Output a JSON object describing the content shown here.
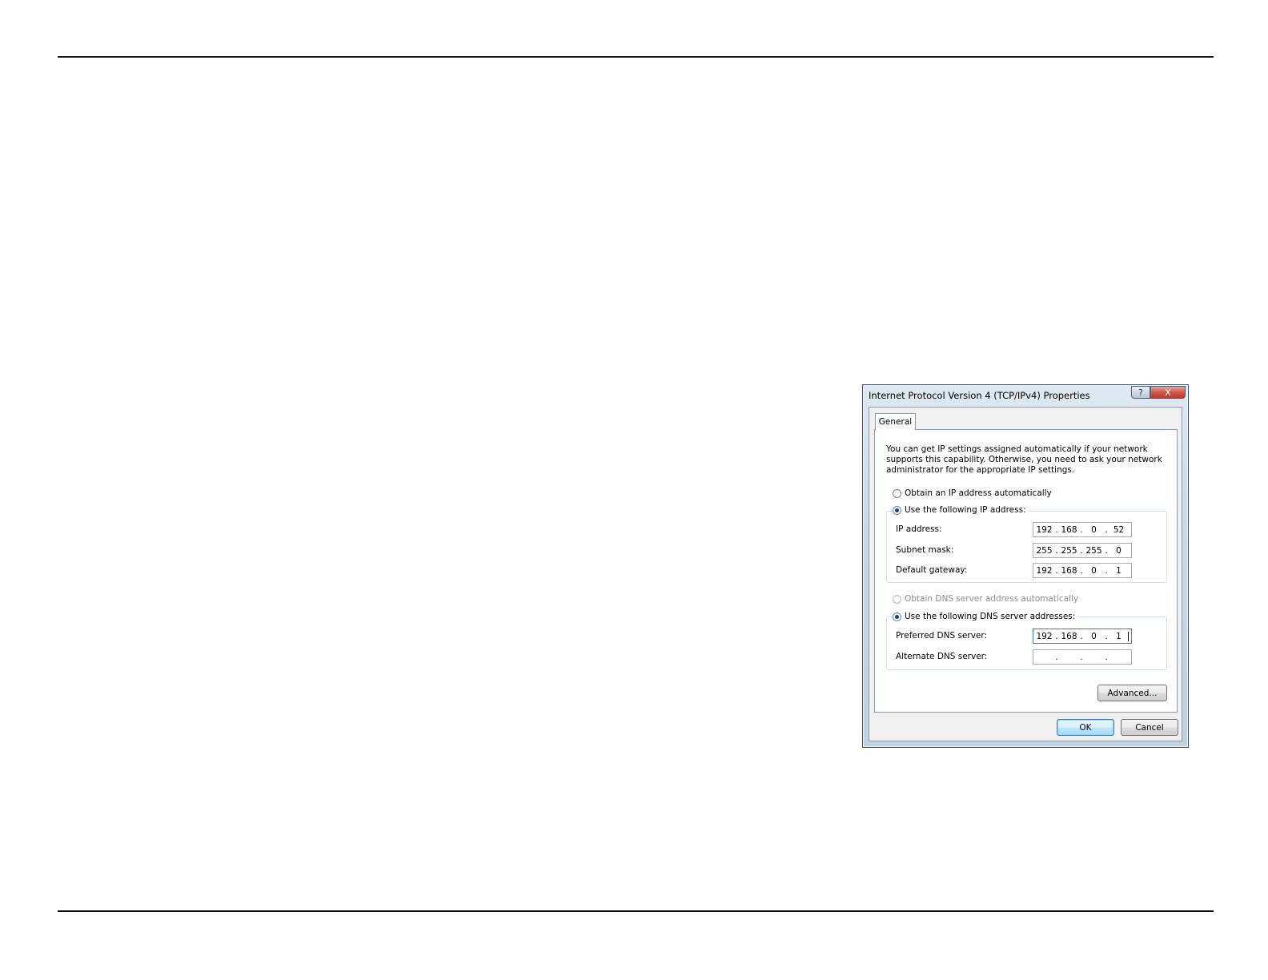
{
  "dialog": {
    "title": "Internet Protocol Version 4 (TCP/IPv4) Properties",
    "help_glyph": "?",
    "close_glyph": "X",
    "tab": "General",
    "description": "You can get IP settings assigned automatically if your network supports this capability. Otherwise, you need to ask your network administrator for the appropriate IP settings.",
    "ip_mode": {
      "auto_label": "Obtain an IP address automatically",
      "manual_label": "Use the following IP address:",
      "selected": "manual"
    },
    "ip_fields": {
      "ip_address": {
        "label": "IP address:",
        "value": [
          "192",
          "168",
          "0",
          "52"
        ]
      },
      "subnet_mask": {
        "label": "Subnet mask:",
        "value": [
          "255",
          "255",
          "255",
          "0"
        ]
      },
      "default_gateway": {
        "label": "Default gateway:",
        "value": [
          "192",
          "168",
          "0",
          "1"
        ]
      }
    },
    "dns_mode": {
      "auto_label": "Obtain DNS server address automatically",
      "manual_label": "Use the following DNS server addresses:",
      "selected": "manual",
      "auto_disabled": true
    },
    "dns_fields": {
      "preferred": {
        "label": "Preferred DNS server:",
        "value": [
          "192",
          "168",
          "0",
          "1"
        ]
      },
      "alternate": {
        "label": "Alternate DNS server:",
        "value": [
          "",
          "",
          "",
          ""
        ]
      }
    },
    "buttons": {
      "advanced": "Advanced...",
      "ok": "OK",
      "cancel": "Cancel"
    }
  }
}
